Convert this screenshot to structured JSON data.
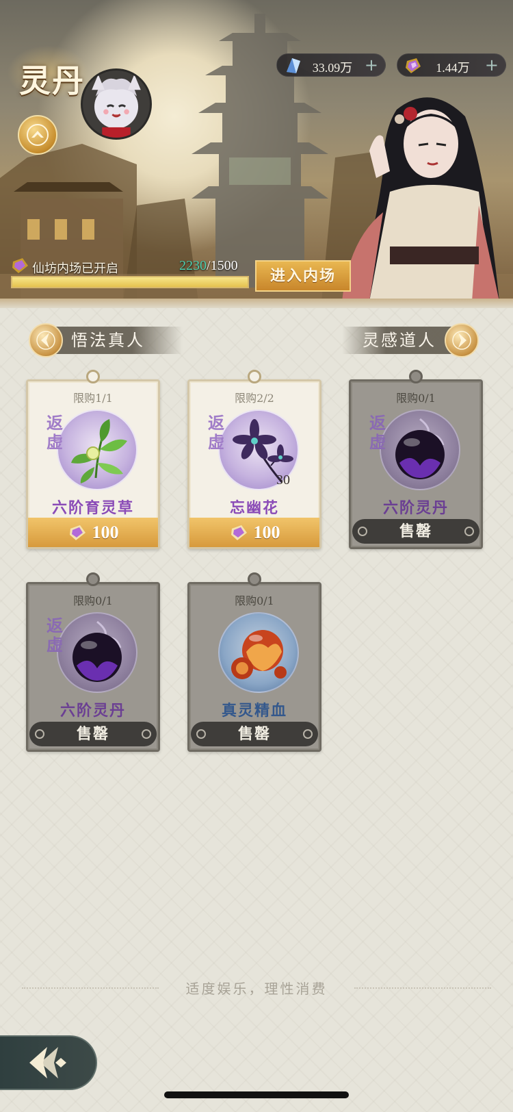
{
  "header": {
    "title": "灵丹",
    "currencies": [
      {
        "icon": "spirit-crystal-icon",
        "amount": "33.09万"
      },
      {
        "icon": "purple-token-icon",
        "amount": "1.44万"
      }
    ],
    "progress": {
      "label": "仙坊内场已开启",
      "current": "2230",
      "separator": "/",
      "max": "1500",
      "fill_fraction": 1.0
    },
    "enter_button": "进入内场"
  },
  "npc_nav": {
    "left_label": "悟法真人",
    "right_label": "灵感道人"
  },
  "items": [
    {
      "limit": "限购1/1",
      "grade": "返虚",
      "name": "六阶育灵草",
      "price": "100",
      "quantity": "",
      "sold_out": false,
      "icon": "herb-icon"
    },
    {
      "limit": "限购2/2",
      "grade": "返虚",
      "name": "忘幽花",
      "price": "100",
      "quantity": "30",
      "sold_out": false,
      "icon": "dark-flower-icon"
    },
    {
      "limit": "限购0/1",
      "grade": "返虚",
      "name": "六阶灵丹",
      "sold_label": "售罄",
      "sold_out": true,
      "icon": "purple-pill-icon"
    },
    {
      "limit": "限购0/1",
      "grade": "返虚",
      "name": "六阶灵丹",
      "sold_label": "售罄",
      "sold_out": true,
      "icon": "purple-pill-icon"
    },
    {
      "limit": "限购0/1",
      "grade": "",
      "name": "真灵精血",
      "sold_label": "售罄",
      "sold_out": true,
      "icon": "blood-orb-icon"
    }
  ],
  "footer": {
    "notice": "适度娱乐，理性消费"
  },
  "colors": {
    "accent_gold": "#d79a3c",
    "purple_name": "#8a4bb7",
    "blue_name": "#3d6aa6",
    "progress_current": "#4fd0b0"
  }
}
